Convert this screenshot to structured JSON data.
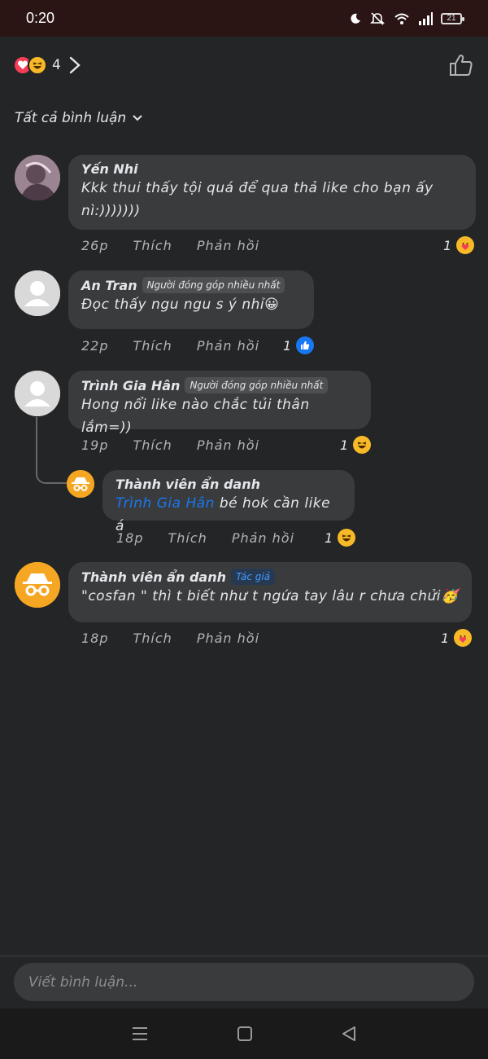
{
  "status_bar": {
    "time": "0:20",
    "battery": "21"
  },
  "header": {
    "reaction_count": "4"
  },
  "filter": {
    "label": "Tất cả bình luận"
  },
  "comments": [
    {
      "author": "Yến Nhi",
      "text_line1": "Kkk thui thấy tội quá để qua thả like cho bạn ấy",
      "text_line2": "nì:)))))))",
      "time": "26p",
      "like": "Thích",
      "reply": "Phản hồi",
      "reactions": "1"
    },
    {
      "author": "An Tran",
      "badge": "Người đóng góp nhiều nhất",
      "text": "Đọc thấy ngu ngu s ý nhỉ😀",
      "time": "22p",
      "like": "Thích",
      "reply": "Phản hồi",
      "reactions": "1"
    },
    {
      "author": "Trình Gia Hân",
      "badge": "Người đóng góp nhiều nhất",
      "text": "Hong nổi like nào chắc tủi thân lắm=))",
      "time": "19p",
      "like": "Thích",
      "reply": "Phản hồi",
      "reactions": "1",
      "reply_comment": {
        "author": "Thành viên ẩn danh",
        "mention": "Trình Gia Hân",
        "text": " bé hok cần like á",
        "time": "18p",
        "like": "Thích",
        "reply": "Phản hồi",
        "reactions": "1"
      }
    },
    {
      "author": "Thành viên ẩn danh",
      "badge": "Tác giả",
      "text": "\"cosfan \" thì t biết như t ngứa tay lâu r chưa chửi🥳",
      "time": "18p",
      "like": "Thích",
      "reply": "Phản hồi",
      "reactions": "1"
    }
  ],
  "composer": {
    "placeholder": "Viết bình luận..."
  },
  "colors": {
    "background": "#242526",
    "bubble": "#3a3b3c",
    "mention": "#1877f2",
    "like_blue": "#1877f2",
    "haha_yellow": "#f7b928",
    "love_red": "#f33e58"
  }
}
